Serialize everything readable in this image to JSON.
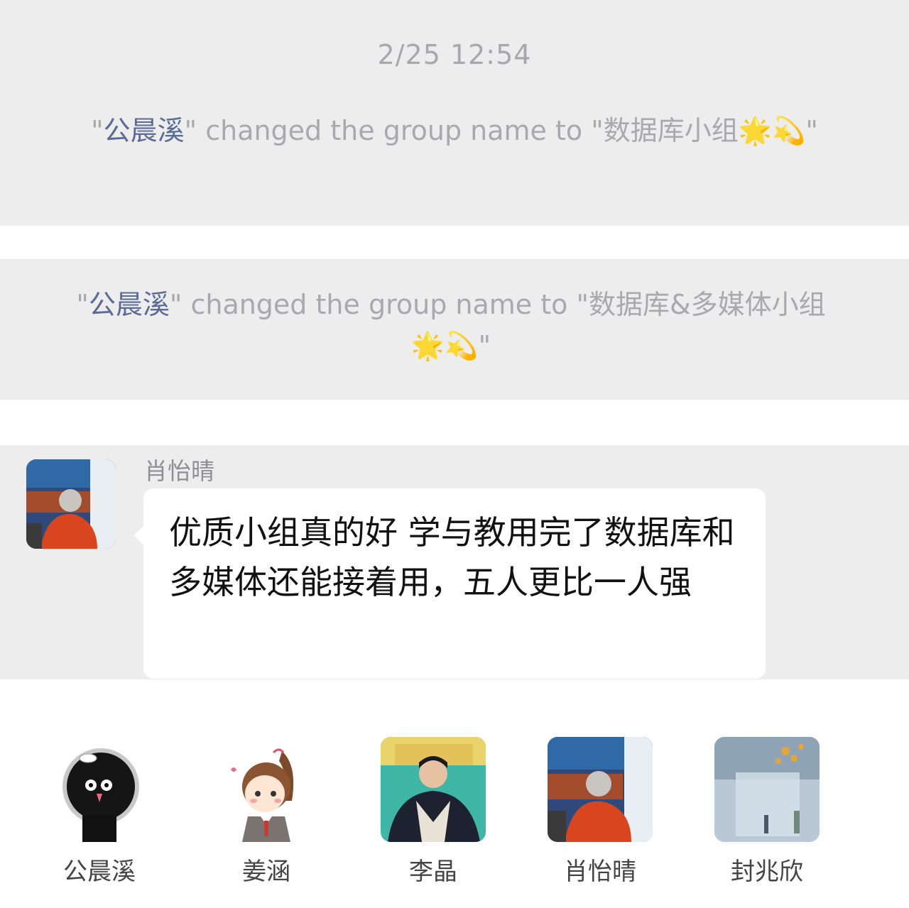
{
  "timeline": {
    "timestamp": "2/25 12:54",
    "system_messages": [
      {
        "actor": "公晨溪",
        "text_prefix": "\"",
        "text_middle": "\" changed the group name to \"数据库小组",
        "emoji": [
          "star-glow",
          "dizzy"
        ],
        "text_suffix": "\""
      },
      {
        "actor": "公晨溪",
        "text_prefix": "\"",
        "text_middle": "\" changed the group name to \"数据库&多媒体小组",
        "emoji": [
          "star-glow",
          "dizzy"
        ],
        "text_suffix": "\""
      }
    ]
  },
  "message": {
    "sender": "肖怡晴",
    "text": "优质小组真的好 学与教用完了数据库和多媒体还能接着用，五人更比一人强"
  },
  "members": [
    {
      "name": "公晨溪"
    },
    {
      "name": "姜涵"
    },
    {
      "name": "李晶"
    },
    {
      "name": "肖怡晴"
    },
    {
      "name": "封兆欣"
    }
  ],
  "emoji_glyphs": {
    "star-glow": "🌟",
    "dizzy": "💫"
  },
  "colors": {
    "panel_bg": "#ededee",
    "name_link": "#5a6b96",
    "system_text": "#a9a9ad"
  }
}
